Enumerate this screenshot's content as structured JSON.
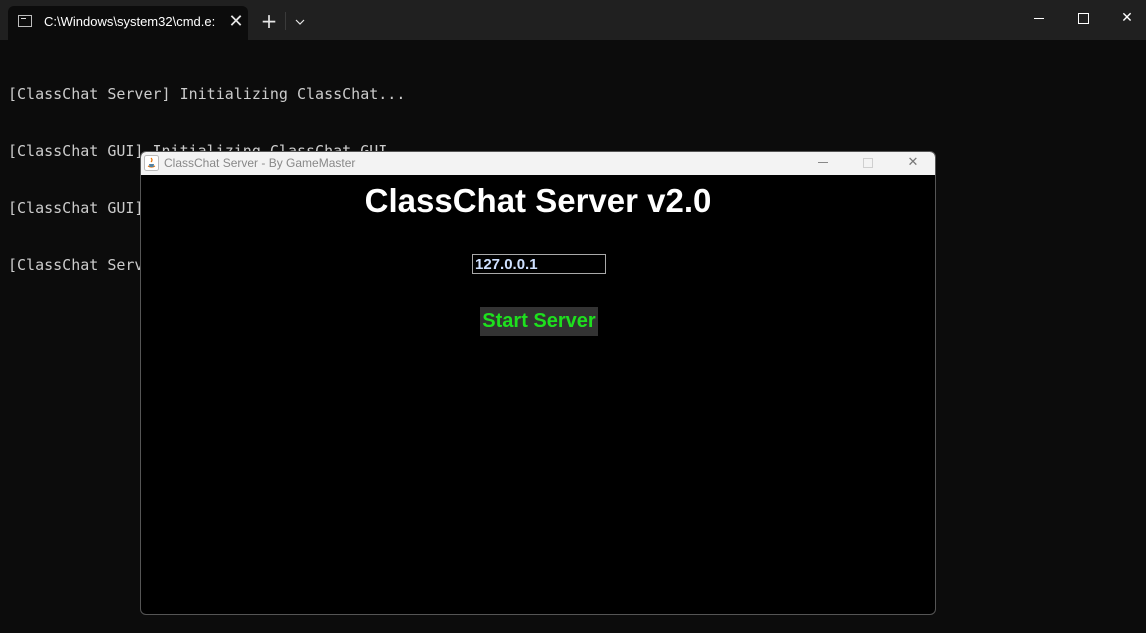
{
  "terminal": {
    "tab_title": "C:\\Windows\\system32\\cmd.e:",
    "tab_close": "✕",
    "new_tab": "+",
    "dropdown": "⌄",
    "close_glyph": "✕",
    "output_lines": [
      "[ClassChat Server] Initializing ClassChat...",
      "[ClassChat GUI] Initializing ClassChat GUI...",
      "[ClassChat GUI] Initialized ClassChat GUI",
      "[ClassChat Server] Discord RichPresence was disabled: start argument"
    ]
  },
  "app": {
    "window_title": "ClassChat Server - By GameMaster",
    "close_glyph": "✕",
    "heading": "ClassChat Server v2.0",
    "ip_value": "127.0.0.1",
    "start_button": "Start Server"
  },
  "colors": {
    "terminal_bg": "#0c0c0c",
    "terminal_text": "#cccccc",
    "button_text": "#1ee01e",
    "button_bg": "#333333"
  }
}
